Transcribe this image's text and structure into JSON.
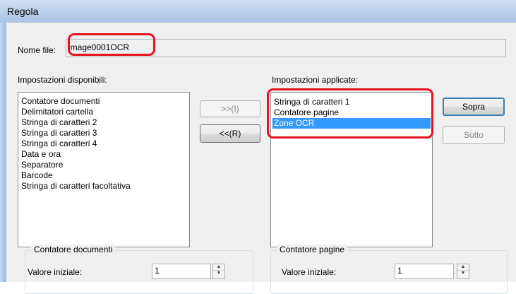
{
  "window": {
    "title": "Regola"
  },
  "file_name": {
    "label": "Nome file:",
    "value": "image0001OCR"
  },
  "available": {
    "label": "Impostazioni disponibili:",
    "items": [
      "Contatore documenti",
      "Delimitatori cartella",
      "Stringa di caratteri 2",
      "Stringa di caratteri 3",
      "Stringa di caratteri 4",
      "Data e ora",
      "Separatore",
      "Barcode",
      "Stringa di caratteri facoltativa"
    ]
  },
  "buttons": {
    "add": ">>(I)",
    "remove": "<<(R)",
    "up": "Sopra",
    "down": "Sotto"
  },
  "applied": {
    "label": "Impostazioni applicate:",
    "items": [
      "Stringa di caratteri 1",
      "Contatore pagine",
      "Zone OCR"
    ],
    "selected_index": 2
  },
  "doc_counter": {
    "title": "Contatore documenti",
    "initial_label": "Valore iniziale:",
    "initial_value": "1"
  },
  "page_counter": {
    "title": "Contatore pagine",
    "initial_label": "Valore iniziale:",
    "initial_value": "1"
  },
  "colors": {
    "highlight": "#e8131e",
    "selection": "#3399ff",
    "title_bar": "#b9cfeb"
  },
  "icons": {
    "spin_up": "▲",
    "spin_down": "▼"
  }
}
